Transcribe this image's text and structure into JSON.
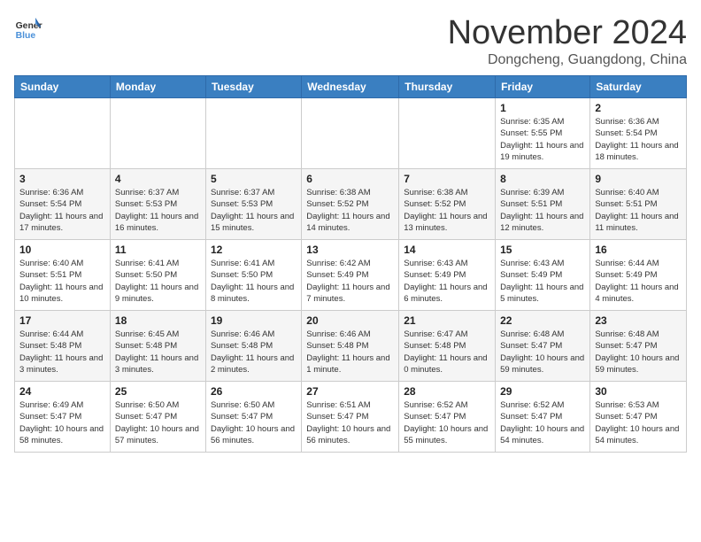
{
  "logo": {
    "line1": "General",
    "line2": "Blue"
  },
  "title": "November 2024",
  "location": "Dongcheng, Guangdong, China",
  "weekdays": [
    "Sunday",
    "Monday",
    "Tuesday",
    "Wednesday",
    "Thursday",
    "Friday",
    "Saturday"
  ],
  "weeks": [
    [
      {
        "day": "",
        "info": ""
      },
      {
        "day": "",
        "info": ""
      },
      {
        "day": "",
        "info": ""
      },
      {
        "day": "",
        "info": ""
      },
      {
        "day": "",
        "info": ""
      },
      {
        "day": "1",
        "info": "Sunrise: 6:35 AM\nSunset: 5:55 PM\nDaylight: 11 hours and 19 minutes."
      },
      {
        "day": "2",
        "info": "Sunrise: 6:36 AM\nSunset: 5:54 PM\nDaylight: 11 hours and 18 minutes."
      }
    ],
    [
      {
        "day": "3",
        "info": "Sunrise: 6:36 AM\nSunset: 5:54 PM\nDaylight: 11 hours and 17 minutes."
      },
      {
        "day": "4",
        "info": "Sunrise: 6:37 AM\nSunset: 5:53 PM\nDaylight: 11 hours and 16 minutes."
      },
      {
        "day": "5",
        "info": "Sunrise: 6:37 AM\nSunset: 5:53 PM\nDaylight: 11 hours and 15 minutes."
      },
      {
        "day": "6",
        "info": "Sunrise: 6:38 AM\nSunset: 5:52 PM\nDaylight: 11 hours and 14 minutes."
      },
      {
        "day": "7",
        "info": "Sunrise: 6:38 AM\nSunset: 5:52 PM\nDaylight: 11 hours and 13 minutes."
      },
      {
        "day": "8",
        "info": "Sunrise: 6:39 AM\nSunset: 5:51 PM\nDaylight: 11 hours and 12 minutes."
      },
      {
        "day": "9",
        "info": "Sunrise: 6:40 AM\nSunset: 5:51 PM\nDaylight: 11 hours and 11 minutes."
      }
    ],
    [
      {
        "day": "10",
        "info": "Sunrise: 6:40 AM\nSunset: 5:51 PM\nDaylight: 11 hours and 10 minutes."
      },
      {
        "day": "11",
        "info": "Sunrise: 6:41 AM\nSunset: 5:50 PM\nDaylight: 11 hours and 9 minutes."
      },
      {
        "day": "12",
        "info": "Sunrise: 6:41 AM\nSunset: 5:50 PM\nDaylight: 11 hours and 8 minutes."
      },
      {
        "day": "13",
        "info": "Sunrise: 6:42 AM\nSunset: 5:49 PM\nDaylight: 11 hours and 7 minutes."
      },
      {
        "day": "14",
        "info": "Sunrise: 6:43 AM\nSunset: 5:49 PM\nDaylight: 11 hours and 6 minutes."
      },
      {
        "day": "15",
        "info": "Sunrise: 6:43 AM\nSunset: 5:49 PM\nDaylight: 11 hours and 5 minutes."
      },
      {
        "day": "16",
        "info": "Sunrise: 6:44 AM\nSunset: 5:49 PM\nDaylight: 11 hours and 4 minutes."
      }
    ],
    [
      {
        "day": "17",
        "info": "Sunrise: 6:44 AM\nSunset: 5:48 PM\nDaylight: 11 hours and 3 minutes."
      },
      {
        "day": "18",
        "info": "Sunrise: 6:45 AM\nSunset: 5:48 PM\nDaylight: 11 hours and 3 minutes."
      },
      {
        "day": "19",
        "info": "Sunrise: 6:46 AM\nSunset: 5:48 PM\nDaylight: 11 hours and 2 minutes."
      },
      {
        "day": "20",
        "info": "Sunrise: 6:46 AM\nSunset: 5:48 PM\nDaylight: 11 hours and 1 minute."
      },
      {
        "day": "21",
        "info": "Sunrise: 6:47 AM\nSunset: 5:48 PM\nDaylight: 11 hours and 0 minutes."
      },
      {
        "day": "22",
        "info": "Sunrise: 6:48 AM\nSunset: 5:47 PM\nDaylight: 10 hours and 59 minutes."
      },
      {
        "day": "23",
        "info": "Sunrise: 6:48 AM\nSunset: 5:47 PM\nDaylight: 10 hours and 59 minutes."
      }
    ],
    [
      {
        "day": "24",
        "info": "Sunrise: 6:49 AM\nSunset: 5:47 PM\nDaylight: 10 hours and 58 minutes."
      },
      {
        "day": "25",
        "info": "Sunrise: 6:50 AM\nSunset: 5:47 PM\nDaylight: 10 hours and 57 minutes."
      },
      {
        "day": "26",
        "info": "Sunrise: 6:50 AM\nSunset: 5:47 PM\nDaylight: 10 hours and 56 minutes."
      },
      {
        "day": "27",
        "info": "Sunrise: 6:51 AM\nSunset: 5:47 PM\nDaylight: 10 hours and 56 minutes."
      },
      {
        "day": "28",
        "info": "Sunrise: 6:52 AM\nSunset: 5:47 PM\nDaylight: 10 hours and 55 minutes."
      },
      {
        "day": "29",
        "info": "Sunrise: 6:52 AM\nSunset: 5:47 PM\nDaylight: 10 hours and 54 minutes."
      },
      {
        "day": "30",
        "info": "Sunrise: 6:53 AM\nSunset: 5:47 PM\nDaylight: 10 hours and 54 minutes."
      }
    ]
  ]
}
